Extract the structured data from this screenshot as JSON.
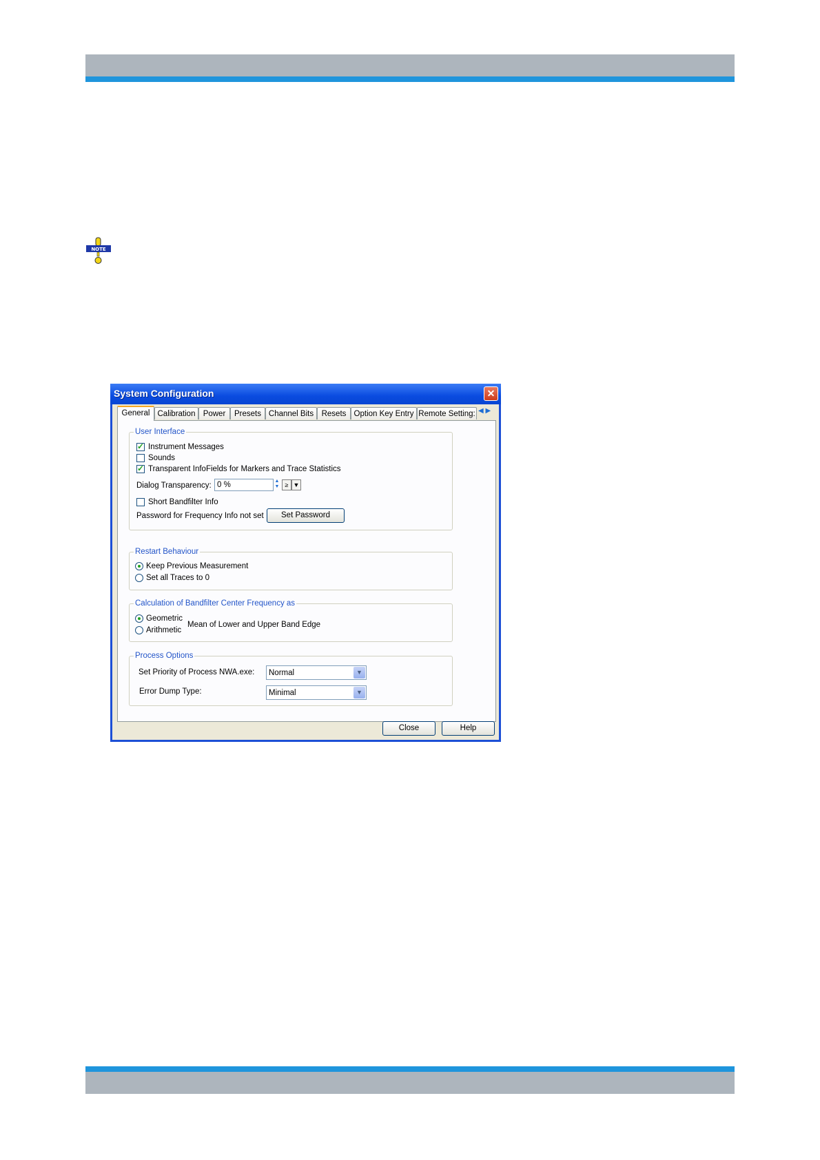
{
  "dialog": {
    "title": "System Configuration",
    "close_glyph": "✕",
    "tabs": [
      {
        "label": "General",
        "active": true
      },
      {
        "label": "Calibration",
        "active": false
      },
      {
        "label": "Power",
        "active": false
      },
      {
        "label": "Presets",
        "active": false
      },
      {
        "label": "Channel Bits",
        "active": false
      },
      {
        "label": "Resets",
        "active": false
      },
      {
        "label": "Option Key Entry",
        "active": false
      },
      {
        "label": "Remote Setting:",
        "active": false
      }
    ],
    "user_interface": {
      "legend": "User Interface",
      "instrument_messages": {
        "label": "Instrument Messages",
        "checked": true
      },
      "sounds": {
        "label": "Sounds",
        "checked": false
      },
      "transparent_infofields": {
        "label": "Transparent InfoFields for Markers and Trace Statistics",
        "checked": true
      },
      "dialog_transparency_label": "Dialog Transparency:",
      "dialog_transparency_value": "0 %",
      "short_bandfilter": {
        "label": "Short Bandfilter Info",
        "checked": false
      },
      "password_label": "Password for Frequency Info not set",
      "set_password_button": "Set Password"
    },
    "restart_behaviour": {
      "legend": "Restart Behaviour",
      "keep_previous": {
        "label": "Keep Previous Measurement",
        "selected": true
      },
      "set_all_traces": {
        "label": "Set all Traces to 0",
        "selected": false
      }
    },
    "bandfilter_calc": {
      "legend": "Calculation of Bandfilter Center Frequency as",
      "geometric": {
        "label": "Geometric",
        "selected": true
      },
      "arithmetic": {
        "label": "Arithmetic",
        "selected": false
      },
      "description": "Mean of Lower and Upper Band Edge"
    },
    "process_options": {
      "legend": "Process Options",
      "priority_label": "Set Priority of Process NWA.exe:",
      "priority_value": "Normal",
      "error_dump_label": "Error Dump Type:",
      "error_dump_value": "Minimal"
    },
    "buttons": {
      "close": "Close",
      "help": "Help"
    }
  }
}
